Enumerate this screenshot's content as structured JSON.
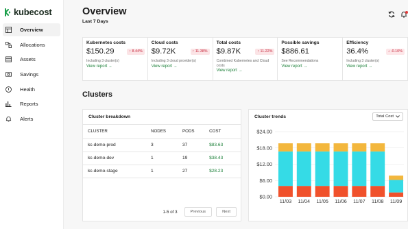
{
  "app": {
    "name": "kubecost"
  },
  "sidebar": {
    "items": [
      {
        "label": "Overview",
        "icon": "grid-icon",
        "active": true
      },
      {
        "label": "Allocations",
        "icon": "allocation-icon",
        "active": false
      },
      {
        "label": "Assets",
        "icon": "assets-icon",
        "active": false
      },
      {
        "label": "Savings",
        "icon": "savings-icon",
        "active": false
      },
      {
        "label": "Health",
        "icon": "health-icon",
        "active": false
      },
      {
        "label": "Reports",
        "icon": "reports-icon",
        "active": false
      },
      {
        "label": "Alerts",
        "icon": "bell-icon",
        "active": false
      }
    ]
  },
  "header": {
    "title": "Overview",
    "subtitle": "Last 7 Days"
  },
  "kpis": [
    {
      "title": "Kubernetes costs",
      "value": "$150.29",
      "badge": "8.44%",
      "direction": "up",
      "note": "Including 3 cluster(s)",
      "link": "View report →"
    },
    {
      "title": "Cloud costs",
      "value": "$9.72K",
      "badge": "11.38%",
      "direction": "up",
      "note": "Including 3 cloud provider(s)",
      "link": "View report →"
    },
    {
      "title": "Total costs",
      "value": "$9.87K",
      "badge": "11.22%",
      "direction": "up",
      "note": "Combined Kubernetes and Cloud costs",
      "link": "View report →"
    },
    {
      "title": "Possible savings",
      "value": "$886.61",
      "badge": "",
      "direction": "",
      "note": "See Recommendations",
      "link": "View report →"
    },
    {
      "title": "Efficiency",
      "value": "36.4%",
      "badge": "-0.10%",
      "direction": "down",
      "note": "Including 3 cluster(s)",
      "link": "View report →"
    }
  ],
  "clusters": {
    "section_title": "Clusters",
    "breakdown": {
      "title": "Cluster breakdown",
      "columns": [
        "CLUSTER",
        "NODES",
        "PODS",
        "COST"
      ],
      "rows": [
        [
          "kc-demo-prod",
          "3",
          "37",
          "$83.63"
        ],
        [
          "kc-demo-dev",
          "1",
          "19",
          "$38.43"
        ],
        [
          "kc-demo-stage",
          "1",
          "27",
          "$28.23"
        ]
      ],
      "pagination": {
        "info": "1-5 of 3",
        "previous": "Previous",
        "next": "Next"
      }
    },
    "trends": {
      "title": "Cluster trends",
      "select_value": "Total Cost"
    }
  },
  "colors": {
    "accent_green": "#1a7f37",
    "badge_red": "#c8283d",
    "series_orange": "#f0512b",
    "series_cyan": "#35dbe6",
    "series_yellow": "#f3b73d"
  },
  "chart_data": {
    "type": "bar",
    "stacked": true,
    "categories": [
      "11/03",
      "11/04",
      "11/05",
      "11/06",
      "11/07",
      "11/08",
      "11/09"
    ],
    "series": [
      {
        "values": [
          4.0,
          4.0,
          4.0,
          4.0,
          4.0,
          4.0,
          1.6
        ]
      },
      {
        "values": [
          12.7,
          12.7,
          12.7,
          12.7,
          12.7,
          12.7,
          4.6
        ]
      },
      {
        "values": [
          3.0,
          3.0,
          3.0,
          3.0,
          3.0,
          3.0,
          1.6
        ]
      }
    ],
    "yticks": [
      "$24.00",
      "$18.00",
      "$12.00",
      "$6.00",
      "$0.00"
    ],
    "ylim": [
      0,
      24
    ],
    "grid": true
  }
}
